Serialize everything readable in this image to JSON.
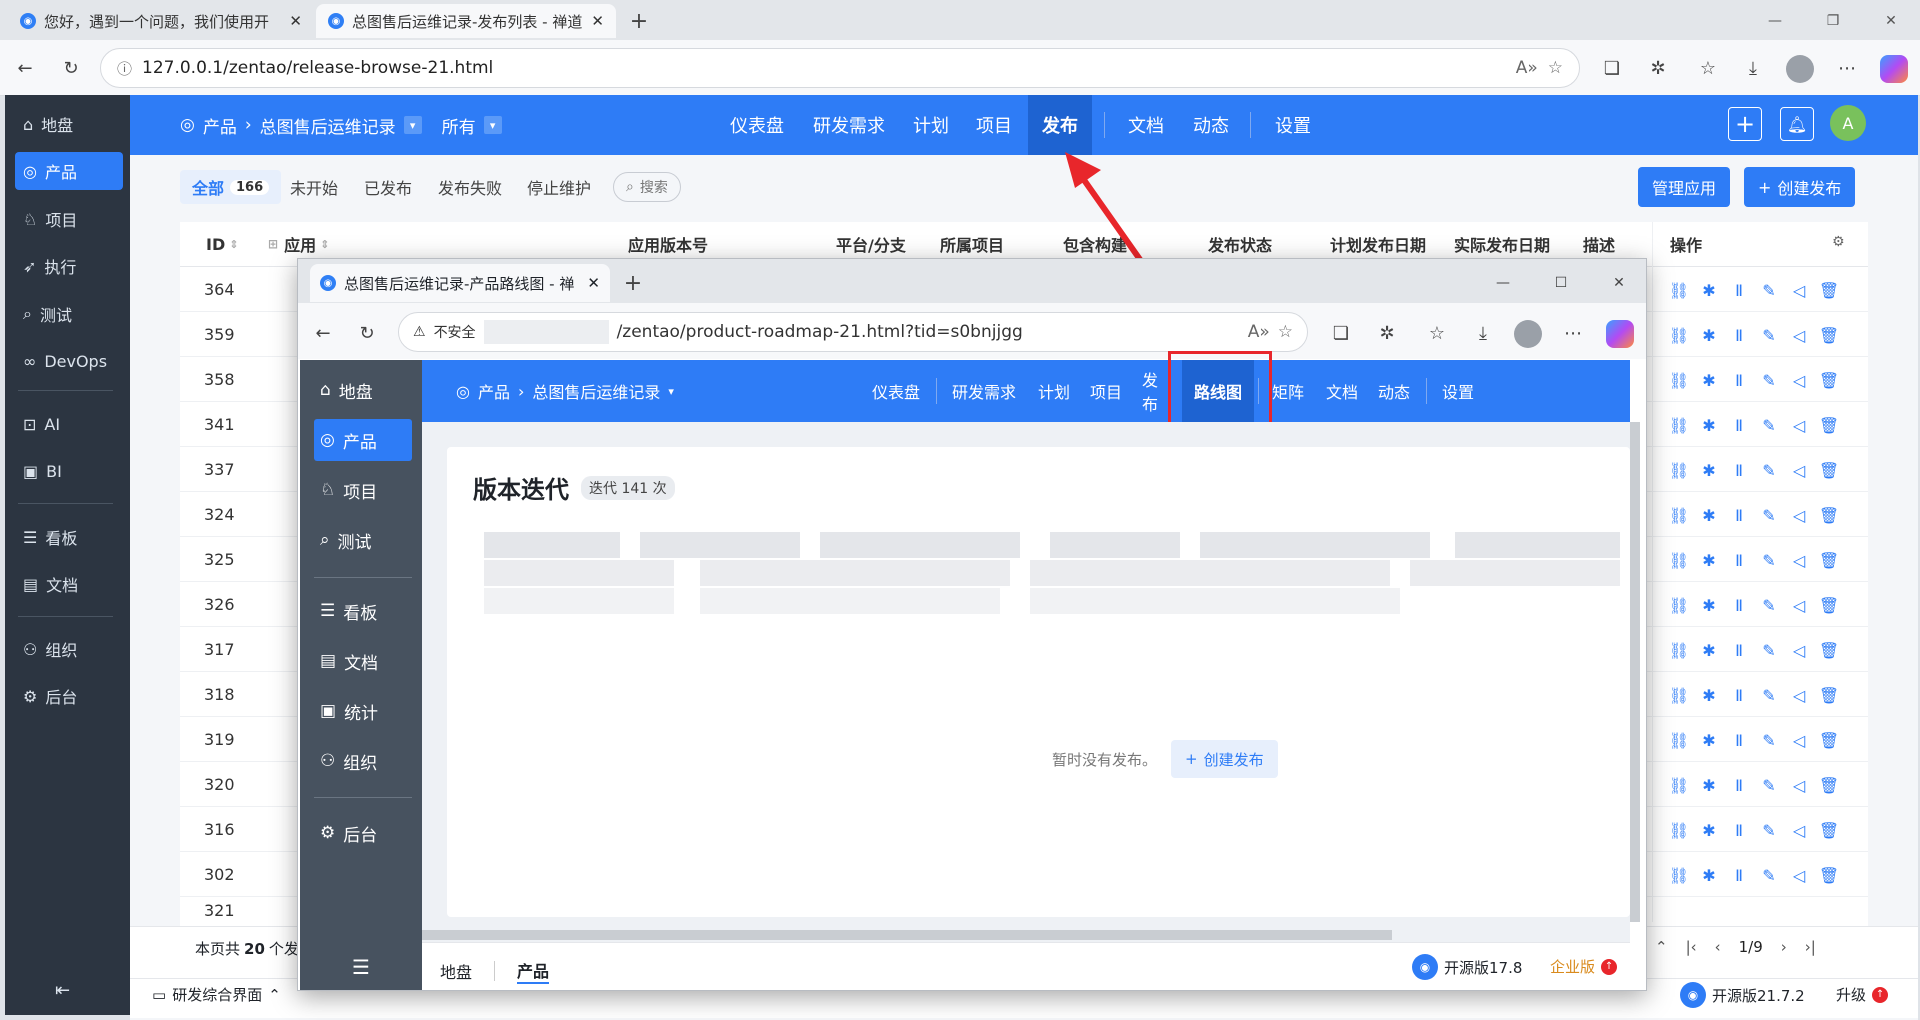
{
  "outer_browser": {
    "tabs": [
      {
        "title": "您好，遇到一个问题，我们使用开"
      },
      {
        "title": "总图售后运维记录-发布列表 - 禅道"
      }
    ],
    "url": "127.0.0.1/zentao/release-browse-21.html"
  },
  "sidebar": {
    "items": [
      {
        "label": "地盘"
      },
      {
        "label": "产品"
      },
      {
        "label": "项目"
      },
      {
        "label": "执行"
      },
      {
        "label": "测试"
      },
      {
        "label": "DevOps"
      },
      {
        "label": "AI"
      },
      {
        "label": "BI"
      },
      {
        "label": "看板"
      },
      {
        "label": "文档"
      },
      {
        "label": "组织"
      },
      {
        "label": "后台"
      }
    ]
  },
  "breadcrumb": {
    "root": "产品",
    "product": "总图售后运维记录",
    "branch": "所有"
  },
  "nav": {
    "items": [
      {
        "label": "仪表盘"
      },
      {
        "label": "研发需求"
      },
      {
        "label": "计划"
      },
      {
        "label": "项目"
      },
      {
        "label": "发布"
      },
      {
        "label": "文档"
      },
      {
        "label": "动态"
      },
      {
        "label": "设置"
      }
    ],
    "avatar": "A"
  },
  "filters": {
    "all": "全部",
    "all_count": "166",
    "items": [
      {
        "label": "未开始"
      },
      {
        "label": "已发布"
      },
      {
        "label": "发布失败"
      },
      {
        "label": "停止维护"
      }
    ],
    "search": "搜索"
  },
  "actions": {
    "manage": "管理应用",
    "create": "创建发布"
  },
  "table": {
    "headers": {
      "id": "ID",
      "app": "应用",
      "version": "应用版本号",
      "platform": "平台/分支",
      "project": "所属项目",
      "build": "包含构建",
      "status": "发布状态",
      "planned": "计划发布日期",
      "actual": "实际发布日期",
      "desc": "描述",
      "ops": "操作"
    },
    "ids": [
      "364",
      "359",
      "358",
      "341",
      "337",
      "324",
      "325",
      "326",
      "317",
      "318",
      "319",
      "320",
      "316",
      "302",
      "321"
    ]
  },
  "footer": {
    "summary": "本页共",
    "count": "20",
    "summary_suffix": "个发",
    "pager": "1/9"
  },
  "bottombar": {
    "left": "研发综合界面",
    "version": "开源版21.7.2",
    "upgrade": "升级"
  },
  "inner_window": {
    "tab_title": "总图售后运维记录-产品路线图 - 禅",
    "insecure": "不安全",
    "url": "/zentao/product-roadmap-21.html?tid=s0bnjjgg",
    "sidebar": {
      "items": [
        {
          "label": "地盘"
        },
        {
          "label": "产品"
        },
        {
          "label": "项目"
        },
        {
          "label": "测试"
        },
        {
          "label": "看板"
        },
        {
          "label": "文档"
        },
        {
          "label": "统计"
        },
        {
          "label": "组织"
        },
        {
          "label": "后台"
        }
      ]
    },
    "breadcrumb": {
      "root": "产品",
      "product": "总图售后运维记录"
    },
    "nav": {
      "items": [
        {
          "label": "仪表盘"
        },
        {
          "label": "研发需求"
        },
        {
          "label": "计划"
        },
        {
          "label": "项目"
        },
        {
          "label": "发布"
        },
        {
          "label": "路线图"
        },
        {
          "label": "矩阵"
        },
        {
          "label": "文档"
        },
        {
          "label": "动态"
        },
        {
          "label": "设置"
        }
      ]
    },
    "heading": "版本迭代",
    "iter_badge": "迭代 141 次",
    "empty_text": "暂时没有发布。",
    "create_btn": "创建发布",
    "footer": {
      "home": "地盘",
      "product": "产品",
      "version": "开源版17.8",
      "enterprise": "企业版"
    }
  }
}
